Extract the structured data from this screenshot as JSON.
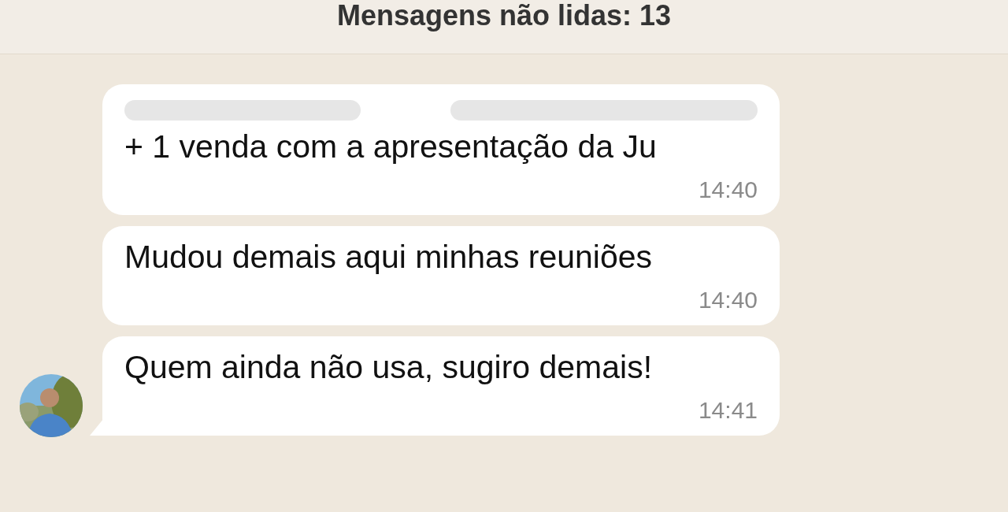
{
  "header": {
    "title": "Mensagens não lidas: 13"
  },
  "messages": [
    {
      "sender_redacted": true,
      "text": "+ 1 venda com a apresentação da Ju",
      "time": "14:40",
      "tail": false
    },
    {
      "sender_redacted": false,
      "text": "Mudou demais aqui minhas reuniões",
      "time": "14:40",
      "tail": false
    },
    {
      "sender_redacted": false,
      "text": "Quem ainda não usa, sugiro demais!",
      "time": "14:41",
      "tail": true
    }
  ]
}
